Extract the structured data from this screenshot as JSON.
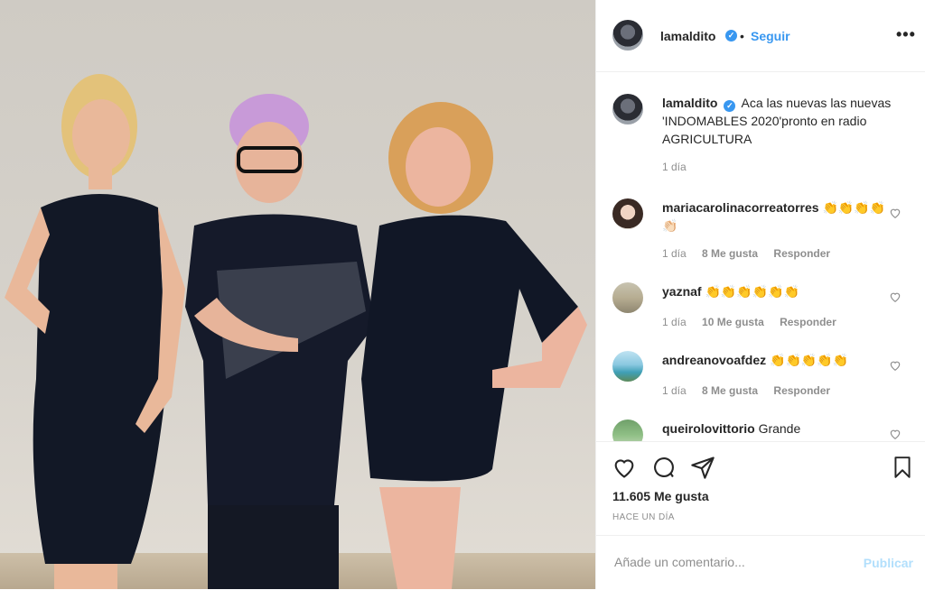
{
  "post": {
    "username": "lamaldito",
    "verified_glyph": "✓",
    "follow_separator": "•",
    "follow_label": "Seguir",
    "more_label": "•••",
    "caption": "Aca las nuevas las nuevas 'INDOMABLES 2020'pronto en radio AGRICULTURA",
    "caption_time": "1 día",
    "photo_description_icon": "photo"
  },
  "comments": [
    {
      "username": "mariacarolinacorreatorres",
      "text": "👏👏👏👏👏🏻",
      "time": "1 día",
      "likes": "8 Me gusta",
      "reply": "Responder"
    },
    {
      "username": "yaznaf",
      "text": "👏👏👏👏👏👏",
      "time": "1 día",
      "likes": "10 Me gusta",
      "reply": "Responder"
    },
    {
      "username": "andreanovoafdez",
      "text": "👏👏👏👏👏",
      "time": "1 día",
      "likes": "8 Me gusta",
      "reply": "Responder"
    },
    {
      "username": "queirolovittorio",
      "text": "Grande"
    }
  ],
  "actions": {
    "like_icon": "heart-icon",
    "comment_icon": "comment-icon",
    "share_icon": "share-icon",
    "save_icon": "bookmark-icon",
    "likes_count": "11.605 Me gusta",
    "time_ago": "HACE UN DÍA",
    "comment_placeholder": "Añade un comentario...",
    "publish_label": "Publicar"
  },
  "colors": {
    "accent": "#3897f0",
    "muted": "#8e8e8e",
    "text": "#262626",
    "publish_disabled": "#b2dffc"
  }
}
